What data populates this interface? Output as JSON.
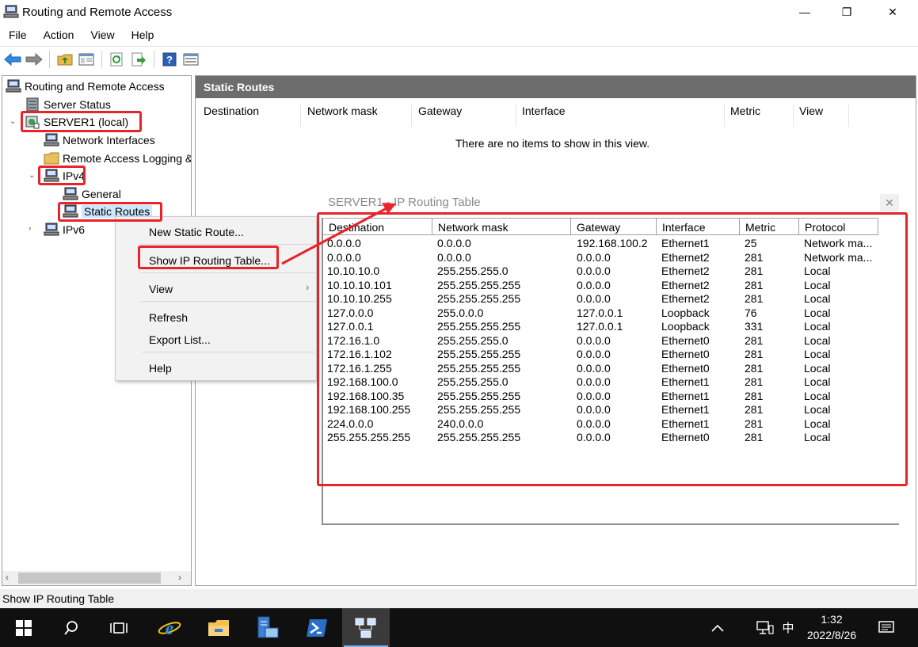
{
  "window": {
    "title": "Routing and Remote Access",
    "controls": {
      "minimize": "—",
      "maximize": "❐",
      "close": "✕"
    }
  },
  "menu": [
    "File",
    "Action",
    "View",
    "Help"
  ],
  "toolbar": {
    "icons": [
      "back-arrow-icon",
      "forward-arrow-icon",
      "up-folder-icon",
      "show-hide-tree-icon",
      "refresh-icon",
      "export-icon",
      "help-icon",
      "properties-icon"
    ]
  },
  "tree": {
    "root": "Routing and Remote Access",
    "server_status": "Server Status",
    "server": "SERVER1 (local)",
    "network_interfaces": "Network Interfaces",
    "remote_access_logging": "Remote Access Logging &",
    "ipv4": "IPv4",
    "general": "General",
    "static_routes": "Static Routes",
    "ipv6": "IPv6"
  },
  "right_pane": {
    "header": "Static Routes",
    "columns": [
      "Destination",
      "Network mask",
      "Gateway",
      "Interface",
      "Metric",
      "View"
    ],
    "empty_message": "There are no items to show in this view."
  },
  "context_menu": {
    "new_static_route": "New Static Route...",
    "show_ip_routing_table": "Show IP Routing Table...",
    "view": "View",
    "view_arrow": "›",
    "refresh": "Refresh",
    "export_list": "Export List...",
    "help": "Help"
  },
  "routing_table": {
    "title": "SERVER1 - IP Routing Table",
    "close": "✕",
    "columns": [
      "Destination",
      "Network mask",
      "Gateway",
      "Interface",
      "Metric",
      "Protocol"
    ],
    "rows": [
      [
        "0.0.0.0",
        "0.0.0.0",
        "192.168.100.2",
        "Ethernet1",
        "25",
        "Network ma..."
      ],
      [
        "0.0.0.0",
        "0.0.0.0",
        "0.0.0.0",
        "Ethernet2",
        "281",
        "Network ma..."
      ],
      [
        "10.10.10.0",
        "255.255.255.0",
        "0.0.0.0",
        "Ethernet2",
        "281",
        "Local"
      ],
      [
        "10.10.10.101",
        "255.255.255.255",
        "0.0.0.0",
        "Ethernet2",
        "281",
        "Local"
      ],
      [
        "10.10.10.255",
        "255.255.255.255",
        "0.0.0.0",
        "Ethernet2",
        "281",
        "Local"
      ],
      [
        "127.0.0.0",
        "255.0.0.0",
        "127.0.0.1",
        "Loopback",
        "76",
        "Local"
      ],
      [
        "127.0.0.1",
        "255.255.255.255",
        "127.0.0.1",
        "Loopback",
        "331",
        "Local"
      ],
      [
        "172.16.1.0",
        "255.255.255.0",
        "0.0.0.0",
        "Ethernet0",
        "281",
        "Local"
      ],
      [
        "172.16.1.102",
        "255.255.255.255",
        "0.0.0.0",
        "Ethernet0",
        "281",
        "Local"
      ],
      [
        "172.16.1.255",
        "255.255.255.255",
        "0.0.0.0",
        "Ethernet0",
        "281",
        "Local"
      ],
      [
        "192.168.100.0",
        "255.255.255.0",
        "0.0.0.0",
        "Ethernet1",
        "281",
        "Local"
      ],
      [
        "192.168.100.35",
        "255.255.255.255",
        "0.0.0.0",
        "Ethernet1",
        "281",
        "Local"
      ],
      [
        "192.168.100.255",
        "255.255.255.255",
        "0.0.0.0",
        "Ethernet1",
        "281",
        "Local"
      ],
      [
        "224.0.0.0",
        "240.0.0.0",
        "0.0.0.0",
        "Ethernet1",
        "281",
        "Local"
      ],
      [
        "255.255.255.255",
        "255.255.255.255",
        "0.0.0.0",
        "Ethernet0",
        "281",
        "Local"
      ]
    ]
  },
  "status_bar": "Show IP Routing Table",
  "taskbar": {
    "apps": [
      "windows-start-icon",
      "search-icon",
      "task-view-icon",
      "internet-explorer-icon",
      "file-explorer-icon",
      "server-manager-icon",
      "powershell-icon",
      "routing-remote-access-icon"
    ],
    "ime": "中",
    "time": "1:32",
    "date": "2022/8/26"
  },
  "colors": {
    "annotation_red": "#e8232a",
    "pane_header": "#6d6d6d",
    "selection": "#cce8ff",
    "taskbar": "#101010"
  }
}
